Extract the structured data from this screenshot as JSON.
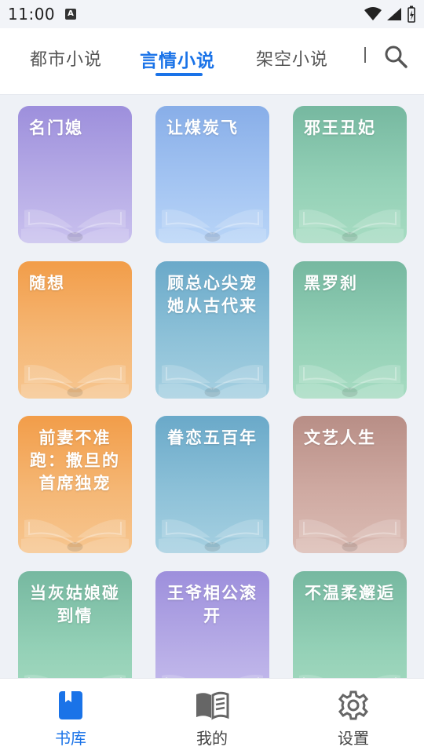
{
  "status_bar": {
    "time": "11:00",
    "notification_icon_letter": "A",
    "icons": [
      "wifi-icon",
      "signal-icon",
      "battery-charging-icon"
    ]
  },
  "tabs": [
    {
      "label": "都市小说",
      "active": false
    },
    {
      "label": "言情小说",
      "active": true
    },
    {
      "label": "架空小说",
      "active": false
    }
  ],
  "accent_color": "#1a73e8",
  "books": [
    {
      "title": "名门媳",
      "color": "purple",
      "align": "left"
    },
    {
      "title": "让煤炭飞",
      "color": "blue",
      "align": "left"
    },
    {
      "title": "邪王丑妃",
      "color": "green",
      "align": "left"
    },
    {
      "title": "随想",
      "color": "orange",
      "align": "left"
    },
    {
      "title": "顾总心尖宠她从古代来",
      "color": "teal",
      "align": "center"
    },
    {
      "title": "黑罗刹",
      "color": "green",
      "align": "left"
    },
    {
      "title": "前妻不准跑：撒旦的首席独宠",
      "color": "orange",
      "align": "center"
    },
    {
      "title": "眷恋五百年",
      "color": "teal",
      "align": "center"
    },
    {
      "title": "文艺人生",
      "color": "mauve",
      "align": "left"
    },
    {
      "title": "当灰姑娘碰到情",
      "color": "green",
      "align": "center"
    },
    {
      "title": "王爷相公滚开",
      "color": "purple",
      "align": "center"
    },
    {
      "title": "不温柔邂逅",
      "color": "green",
      "align": "center"
    }
  ],
  "bottom_nav": [
    {
      "label": "书库",
      "icon": "bookmark-book-icon",
      "active": true
    },
    {
      "label": "我的",
      "icon": "open-book-icon",
      "active": false
    },
    {
      "label": "设置",
      "icon": "gear-icon",
      "active": false
    }
  ]
}
